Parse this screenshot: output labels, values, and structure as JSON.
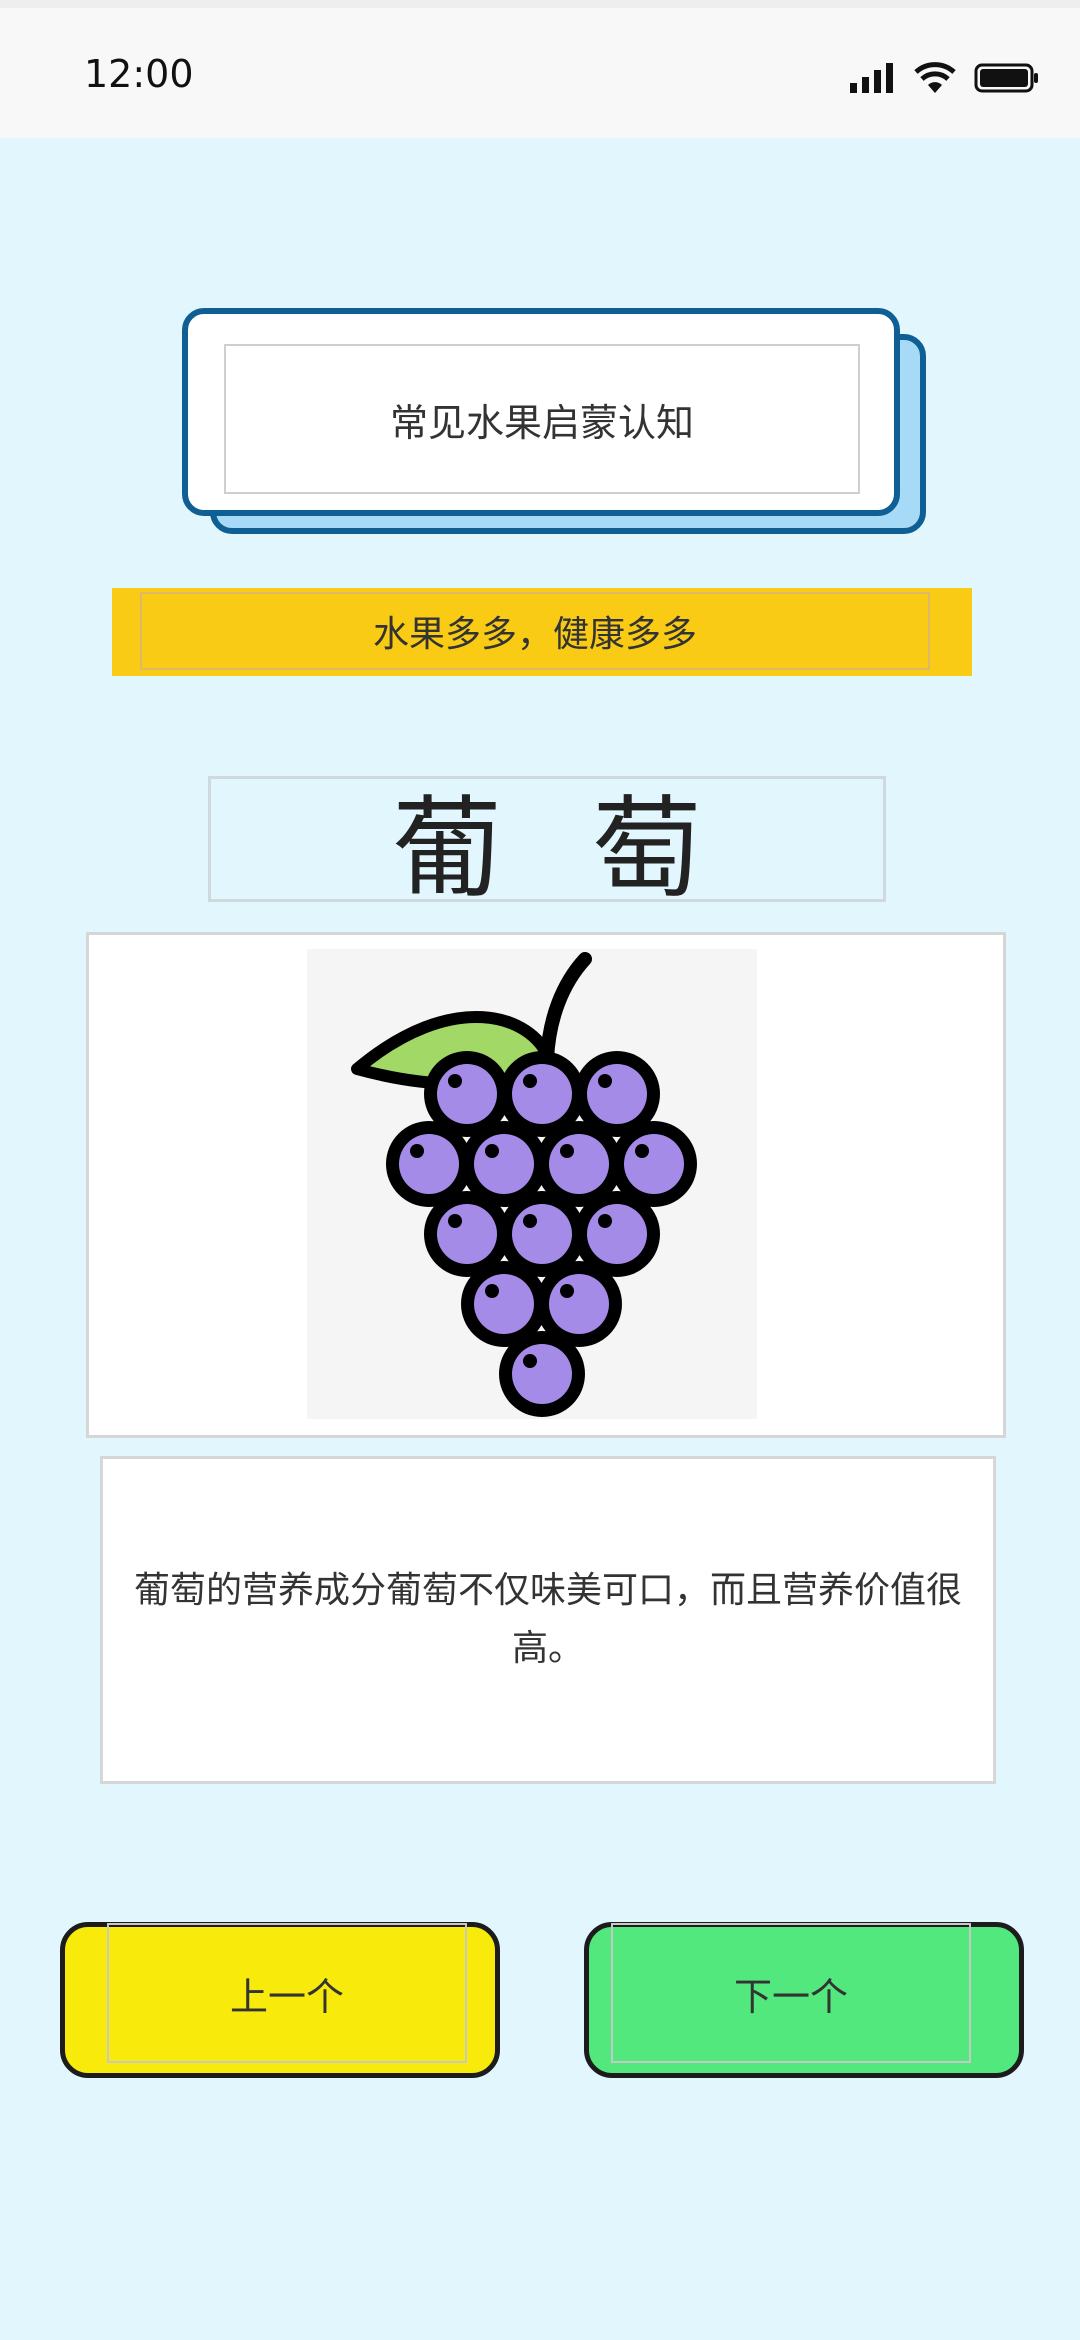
{
  "status_bar": {
    "time": "12:00",
    "icons": [
      "signal-icon",
      "wifi-icon",
      "battery-icon"
    ]
  },
  "header": {
    "title": "常见水果启蒙认知",
    "slogan": "水果多多，健康多多"
  },
  "fruit": {
    "name": "葡萄",
    "image": "grape-illustration",
    "description": "葡萄的营养成分葡萄不仅味美可口，而且营养价值很高。"
  },
  "navigation": {
    "prev_label": "上一个",
    "next_label": "下一个"
  },
  "colors": {
    "background": "#e1f6fd",
    "title_border": "#0f5e94",
    "slogan_bg": "#f9cb14",
    "prev_button": "#f8eb0c",
    "next_button": "#53e87e",
    "grape": "#a58be8",
    "leaf": "#a2d865"
  }
}
